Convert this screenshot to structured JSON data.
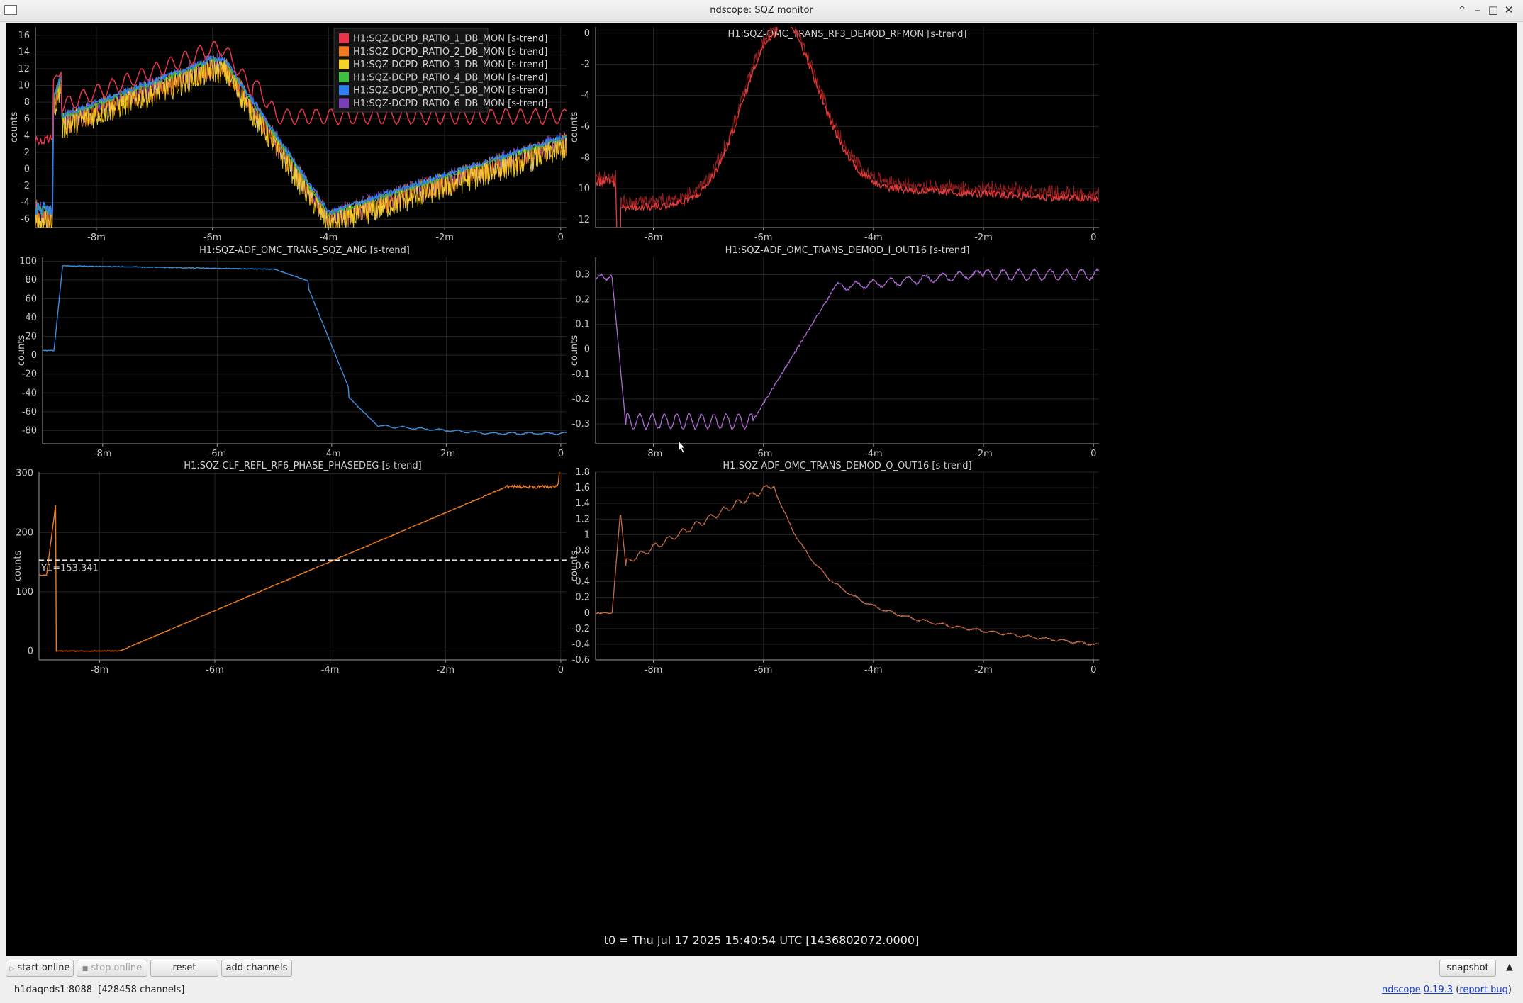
{
  "window": {
    "title": "ndscope: SQZ monitor"
  },
  "x_ticks": [
    "-8m",
    "-6m",
    "-4m",
    "-2m",
    "0"
  ],
  "plots": [
    {
      "id": "p1",
      "title": "",
      "ylabel": "counts",
      "ylim": [
        -7,
        17
      ],
      "yticks": [
        "16",
        "14",
        "12",
        "10",
        "8",
        "6",
        "4",
        "2",
        "0",
        "-2",
        "-4",
        "-6"
      ],
      "legend": [
        {
          "label": "H1:SQZ-DCPD_RATIO_1_DB_MON [s-trend]",
          "color": "#e8354a"
        },
        {
          "label": "H1:SQZ-DCPD_RATIO_2_DB_MON [s-trend]",
          "color": "#f07a23"
        },
        {
          "label": "H1:SQZ-DCPD_RATIO_3_DB_MON [s-trend]",
          "color": "#f5d22a"
        },
        {
          "label": "H1:SQZ-DCPD_RATIO_4_DB_MON [s-trend]",
          "color": "#3fbf3f"
        },
        {
          "label": "H1:SQZ-DCPD_RATIO_5_DB_MON [s-trend]",
          "color": "#2f7ff0"
        },
        {
          "label": "H1:SQZ-DCPD_RATIO_6_DB_MON [s-trend]",
          "color": "#7a3fb8"
        }
      ]
    },
    {
      "id": "p2",
      "title": "H1:SQZ-OMC_TRANS_RF3_DEMOD_RFMON [s-trend]",
      "ylabel": "counts",
      "ylim": [
        -12.5,
        0.4
      ],
      "yticks": [
        "0",
        "-2",
        "-4",
        "-6",
        "-8",
        "-10",
        "-12"
      ],
      "color": "#e33b3b"
    },
    {
      "id": "p3",
      "title": "H1:SQZ-ADF_OMC_TRANS_SQZ_ANG [s-trend]",
      "ylabel": "counts",
      "ylim": [
        -94,
        104
      ],
      "yticks": [
        "100",
        "80",
        "60",
        "40",
        "20",
        "0",
        "-20",
        "-40",
        "-60",
        "-80"
      ],
      "color": "#3a8fe0"
    },
    {
      "id": "p4",
      "title": "H1:SQZ-ADF_OMC_TRANS_DEMOD_I_OUT16 [s-trend]",
      "ylabel": "counts",
      "ylim": [
        -0.38,
        0.37
      ],
      "yticks": [
        "0.3",
        "0.2",
        "0.1",
        "0",
        "-0.1",
        "-0.2",
        "-0.3"
      ],
      "color": "#b06ad6"
    },
    {
      "id": "p5",
      "title": "H1:SQZ-CLF_REFL_RF6_PHASE_PHASEDEG [s-trend]",
      "ylabel": "counts",
      "ylim": [
        -15,
        302
      ],
      "yticks": [
        "300",
        "200",
        "100",
        "0"
      ],
      "color": "#f07a1a",
      "cursor_label": "Y1=153.341",
      "cursor_value": 153.341
    },
    {
      "id": "p6",
      "title": "H1:SQZ-ADF_OMC_TRANS_DEMOD_Q_OUT16 [s-trend]",
      "ylabel": "counts",
      "ylim": [
        -0.6,
        1.8
      ],
      "yticks": [
        "1.8",
        "1.6",
        "1.4",
        "1.2",
        "1",
        "0.8",
        "0.6",
        "0.4",
        "0.2",
        "0",
        "-0.2",
        "-0.4",
        "-0.6"
      ],
      "color": "#c46a4a"
    }
  ],
  "t0_text": "t0 = Thu Jul 17 2025 15:40:54 UTC [1436802072.0000]",
  "buttons": {
    "start_online": "start online",
    "stop_online": "stop online",
    "reset": "reset",
    "add_channels": "add channels",
    "snapshot": "snapshot"
  },
  "status": {
    "server": "h1daqnds1:8088",
    "channels": "[428458 channels]",
    "app_name": "ndscope",
    "version": "0.19.3",
    "report_bug": "report bug"
  }
}
